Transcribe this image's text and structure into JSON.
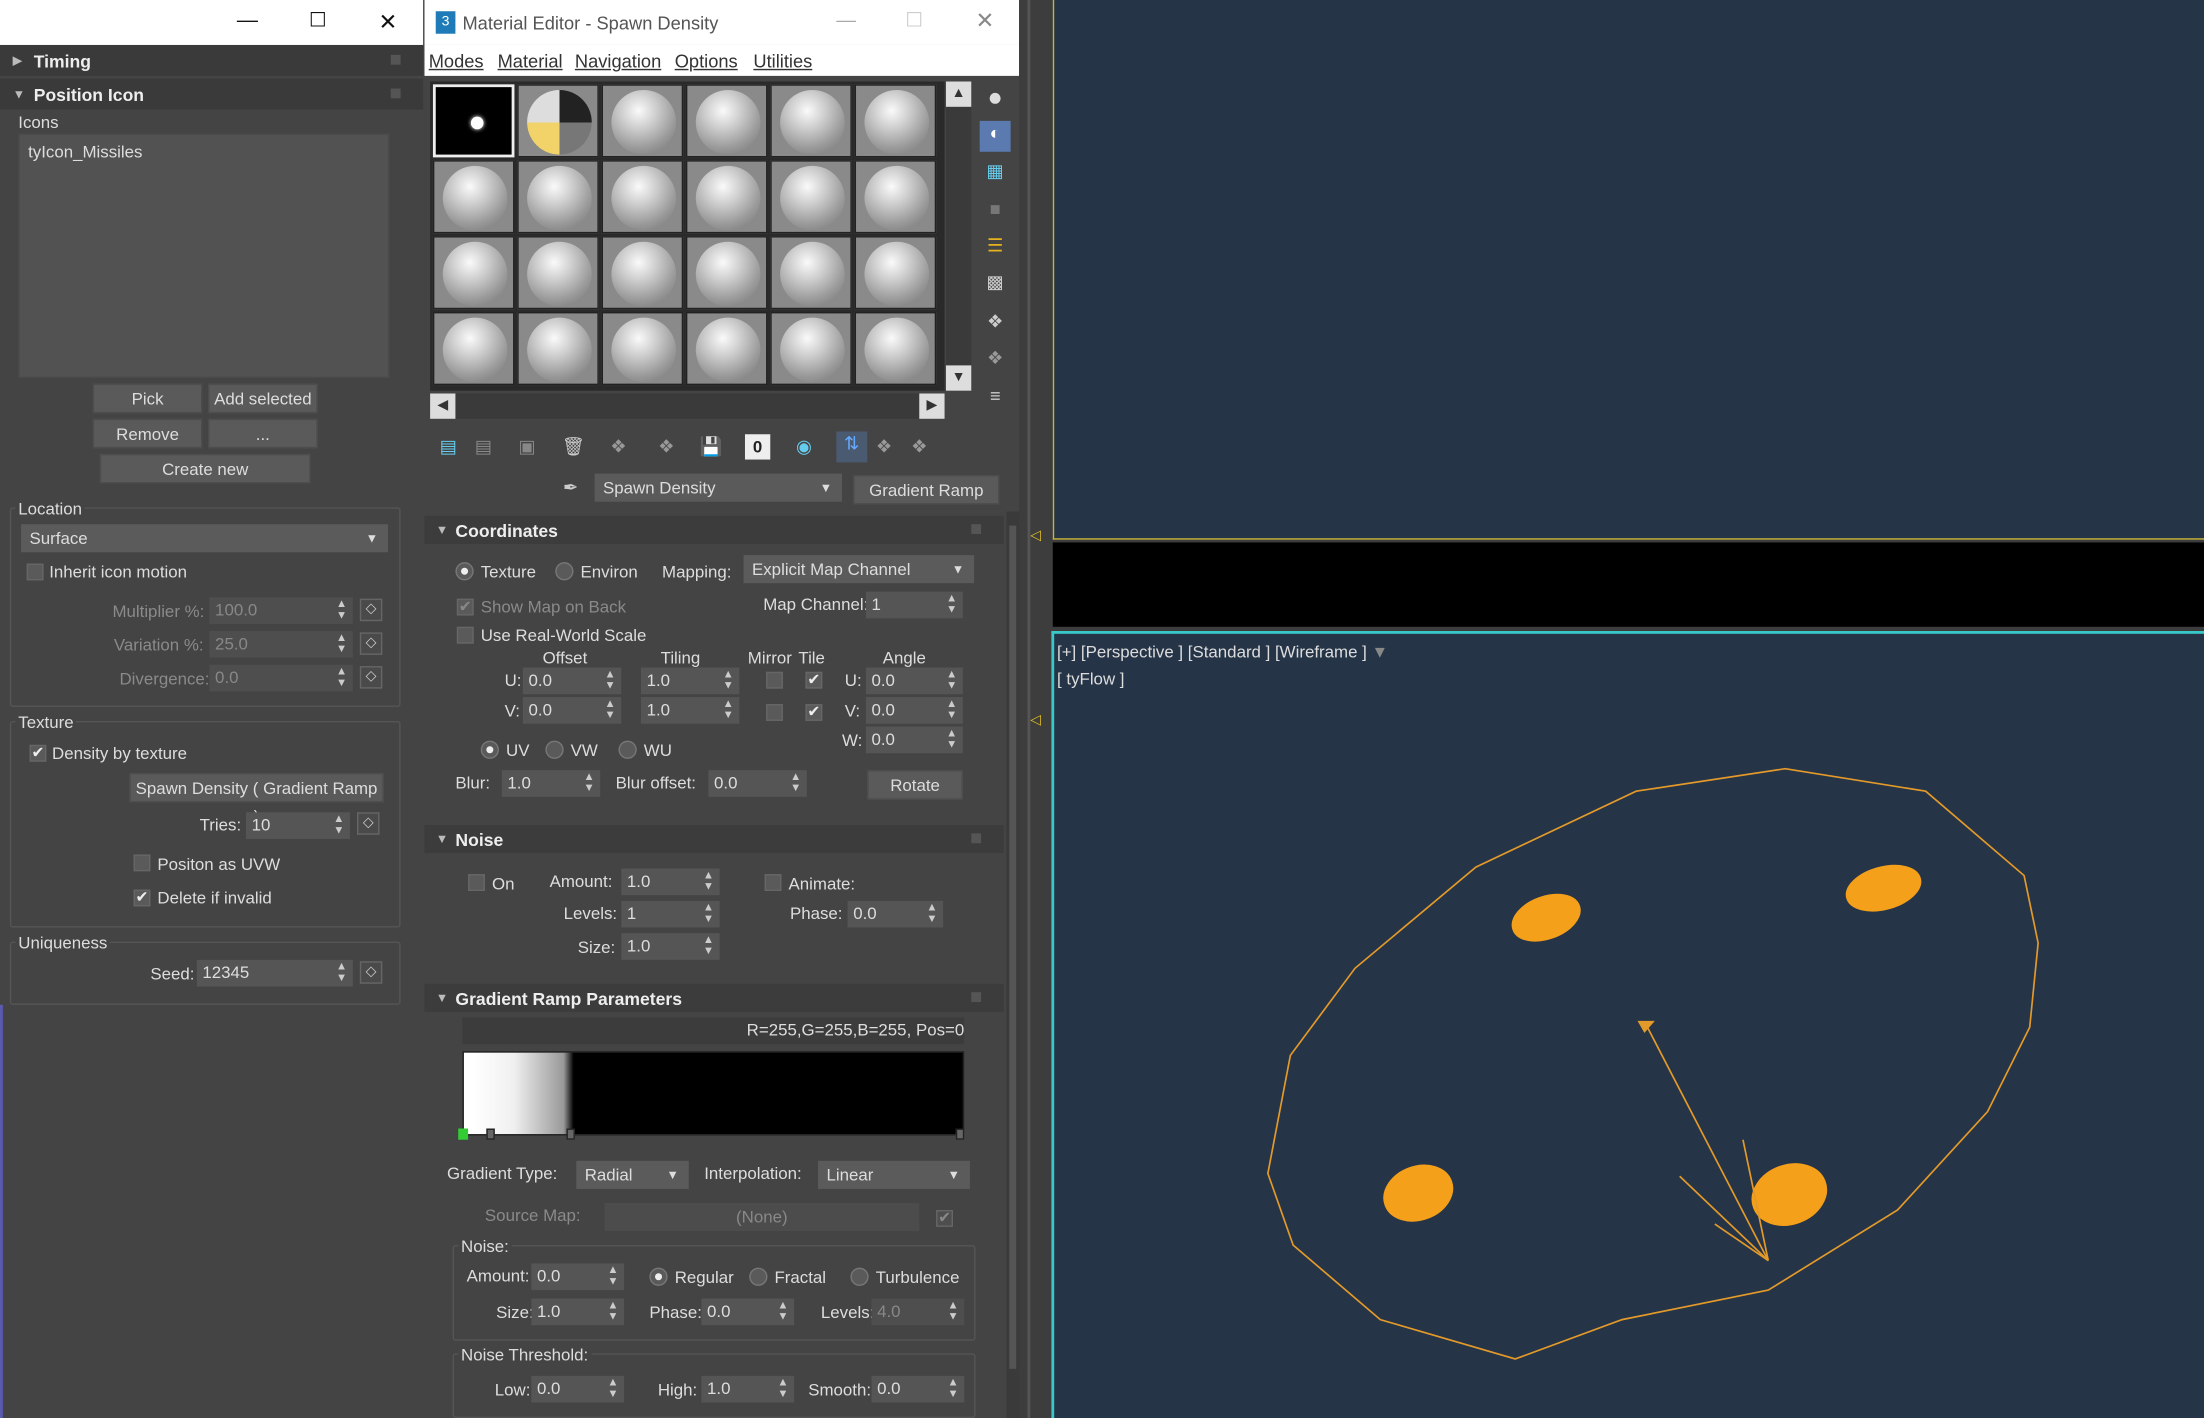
{
  "left_panel": {
    "rollouts": {
      "timing": "Timing",
      "position_icon": "Position Icon"
    },
    "icons": {
      "label": "Icons",
      "items": [
        "tyIcon_Missiles"
      ],
      "pick": "Pick",
      "add_selected": "Add selected",
      "remove": "Remove",
      "more": "...",
      "create_new": "Create new"
    },
    "location": {
      "label": "Location",
      "value": "Surface",
      "inherit": "Inherit icon motion",
      "multiplier_label": "Multiplier %:",
      "multiplier": "100.0",
      "variation_label": "Variation %:",
      "variation": "25.0",
      "divergence_label": "Divergence:",
      "divergence": "0.0"
    },
    "texture": {
      "label": "Texture",
      "density": "Density by texture",
      "map_button": "Spawn Density  ( Gradient Ramp )",
      "tries_label": "Tries:",
      "tries": "10",
      "position_uvw": "Positon as UVW",
      "delete_invalid": "Delete if invalid"
    },
    "uniqueness": {
      "label": "Uniqueness",
      "seed_label": "Seed:",
      "seed": "12345"
    }
  },
  "material_editor": {
    "title": "Material Editor - Spawn Density",
    "menu": [
      "Modes",
      "Material",
      "Navigation",
      "Options",
      "Utilities"
    ],
    "material_name": "Spawn Density",
    "type_button": "Gradient Ramp",
    "coordinates": {
      "title": "Coordinates",
      "texture": "Texture",
      "environ": "Environ",
      "mapping_label": "Mapping:",
      "mapping": "Explicit Map Channel",
      "show_map_on_back": "Show Map on Back",
      "map_channel_label": "Map Channel:",
      "map_channel": "1",
      "real_world": "Use Real-World Scale",
      "headers": {
        "offset": "Offset",
        "tiling": "Tiling",
        "mirror": "Mirror",
        "tile": "Tile",
        "angle": "Angle"
      },
      "u_label": "U:",
      "v_label": "V:",
      "w_label": "W:",
      "offset_u": "0.0",
      "offset_v": "0.0",
      "tiling_u": "1.0",
      "tiling_v": "1.0",
      "angle_u": "0.0",
      "angle_v": "0.0",
      "angle_w": "0.0",
      "uv": "UV",
      "vw": "VW",
      "wu": "WU",
      "blur_label": "Blur:",
      "blur": "1.0",
      "blur_offset_label": "Blur offset:",
      "blur_offset": "0.0",
      "rotate": "Rotate"
    },
    "noise": {
      "title": "Noise",
      "on": "On",
      "amount_label": "Amount:",
      "amount": "1.0",
      "levels_label": "Levels:",
      "levels": "1",
      "size_label": "Size:",
      "size": "1.0",
      "animate": "Animate:",
      "phase_label": "Phase:",
      "phase": "0.0"
    },
    "gradient": {
      "title": "Gradient Ramp Parameters",
      "readout": "R=255,G=255,B=255, Pos=0",
      "type_label": "Gradient Type:",
      "type": "Radial",
      "interp_label": "Interpolation:",
      "interp": "Linear",
      "source_label": "Source Map:",
      "source": "(None)",
      "noise_label": "Noise:",
      "amount_label": "Amount:",
      "amount": "0.0",
      "regular": "Regular",
      "fractal": "Fractal",
      "turbulence": "Turbulence",
      "size_label": "Size:",
      "size": "1.0",
      "phase_label": "Phase:",
      "phase": "0.0",
      "levels_label": "Levels:",
      "levels": "4.0",
      "threshold_label": "Noise Threshold:",
      "low_label": "Low:",
      "low": "0.0",
      "high_label": "High:",
      "high": "1.0",
      "smooth_label": "Smooth:",
      "smooth": "0.0"
    }
  },
  "viewport": {
    "label": "[+] [Perspective ] [Standard ] [Wireframe ]",
    "object": "[ tyFlow ]",
    "accent": "#f5a01a"
  }
}
